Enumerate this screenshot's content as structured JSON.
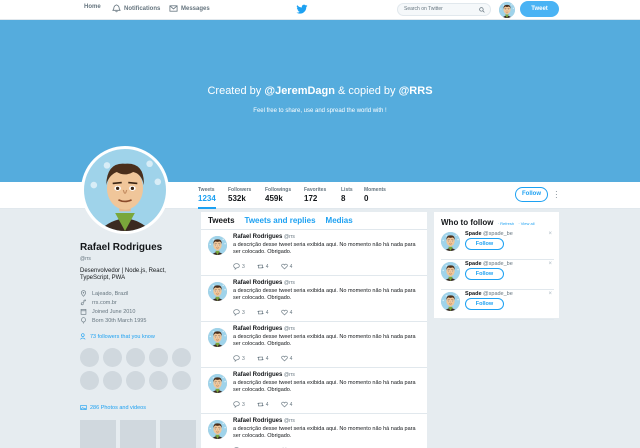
{
  "nav": {
    "home": "Home",
    "notifications": "Notifications",
    "messages": "Messages",
    "search_placeholder": "Search on Twitter",
    "tweet_button": "Tweet"
  },
  "banner": {
    "created_by": "Created by ",
    "author1": "@JeremDagn",
    "copied_by": " & copied by ",
    "author2": "@RRS",
    "subtitle": "Feel free to share, use and spread the world with !"
  },
  "stats": [
    {
      "label": "Tweets",
      "value": "1234"
    },
    {
      "label": "Followers",
      "value": "532k"
    },
    {
      "label": "Followings",
      "value": "459k"
    },
    {
      "label": "Favorites",
      "value": "172"
    },
    {
      "label": "Lists",
      "value": "8"
    },
    {
      "label": "Moments",
      "value": "0"
    }
  ],
  "follow_button": "Follow",
  "profile": {
    "name": "Rafael Rodrigues",
    "handle": "@rrs",
    "bio": "Desenvolvedor | Node.js, React, TypeScript, PWA",
    "location": "Lajeado, Brazil",
    "website": "rrs.com.br",
    "joined": "Joined June 2010",
    "born": "Born 30th March 1995",
    "followers_you_know": "73 followers that you know",
    "photos": "286 Photos and videos"
  },
  "tabs": [
    "Tweets",
    "Tweets and replies",
    "Medias"
  ],
  "tweet": {
    "name": "Rafael Rodrigues",
    "handle": "@rrs",
    "text": "a descrição desse tweet seria exibida aqui. No momento não há nada para ser colocado. Obrigado.",
    "replies": "3",
    "retweets": "4",
    "likes": "4"
  },
  "who_to_follow": {
    "title": "Who to follow",
    "refresh": "· Refresh",
    "view_all": "· View all",
    "items": [
      {
        "name": "Spade",
        "handle": "@spade_be",
        "button": "Follow"
      },
      {
        "name": "Spade",
        "handle": "@spade_be",
        "button": "Follow"
      },
      {
        "name": "Spade",
        "handle": "@spade_be",
        "button": "Follow"
      }
    ]
  },
  "colors": {
    "accent": "#1da1f2",
    "banner": "#55acdd"
  }
}
